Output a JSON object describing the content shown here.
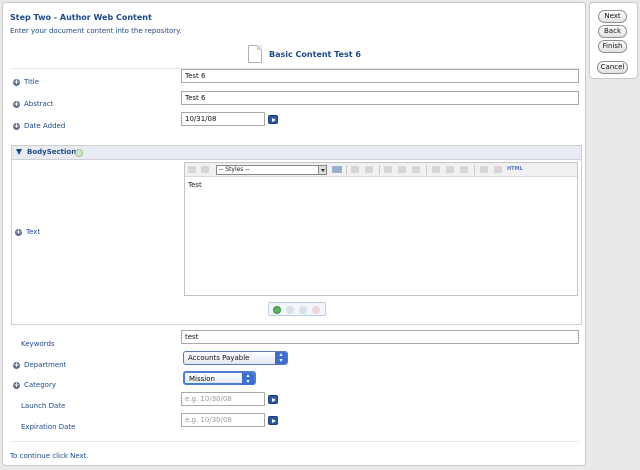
{
  "header": {
    "step_title": "Step Two - Author Web Content",
    "instructions": "Enter your document content into the repository.",
    "content_title": "Basic Content Test 6"
  },
  "side_nav": {
    "next": "Next",
    "back": "Back",
    "finish": "Finish",
    "cancel": "Cancel"
  },
  "fields": {
    "title": {
      "label": "Title",
      "value": "Test 6"
    },
    "abstract": {
      "label": "Abstract",
      "value": "Test 6"
    },
    "date_added": {
      "label": "Date Added",
      "value": "10/31/08"
    },
    "keywords": {
      "label": "Keywords",
      "value": "test"
    },
    "department": {
      "label": "Department",
      "value": "Accounts Payable"
    },
    "category": {
      "label": "Category",
      "value": "Mission"
    },
    "launch_date": {
      "label": "Launch Date",
      "placeholder": "e.g. 10/30/08"
    },
    "expiration_date": {
      "label": "Expiration Date",
      "placeholder": "e.g. 10/30/08"
    }
  },
  "body_section": {
    "title": "BodySection",
    "text_label": "Text",
    "styles_value": "-- Styles --",
    "editor_content": "Test",
    "html_button": "HTML"
  },
  "footer": {
    "text": "To continue click Next."
  },
  "icons": {
    "field_expand": "plus-circle-icon",
    "calendar": "calendar-arrow-icon",
    "section_add": "add-circle-icon"
  },
  "colors": {
    "label_blue": "#1d4a8a",
    "select_accent": "#3d6fd0",
    "button_blue": "#2c58a0"
  }
}
